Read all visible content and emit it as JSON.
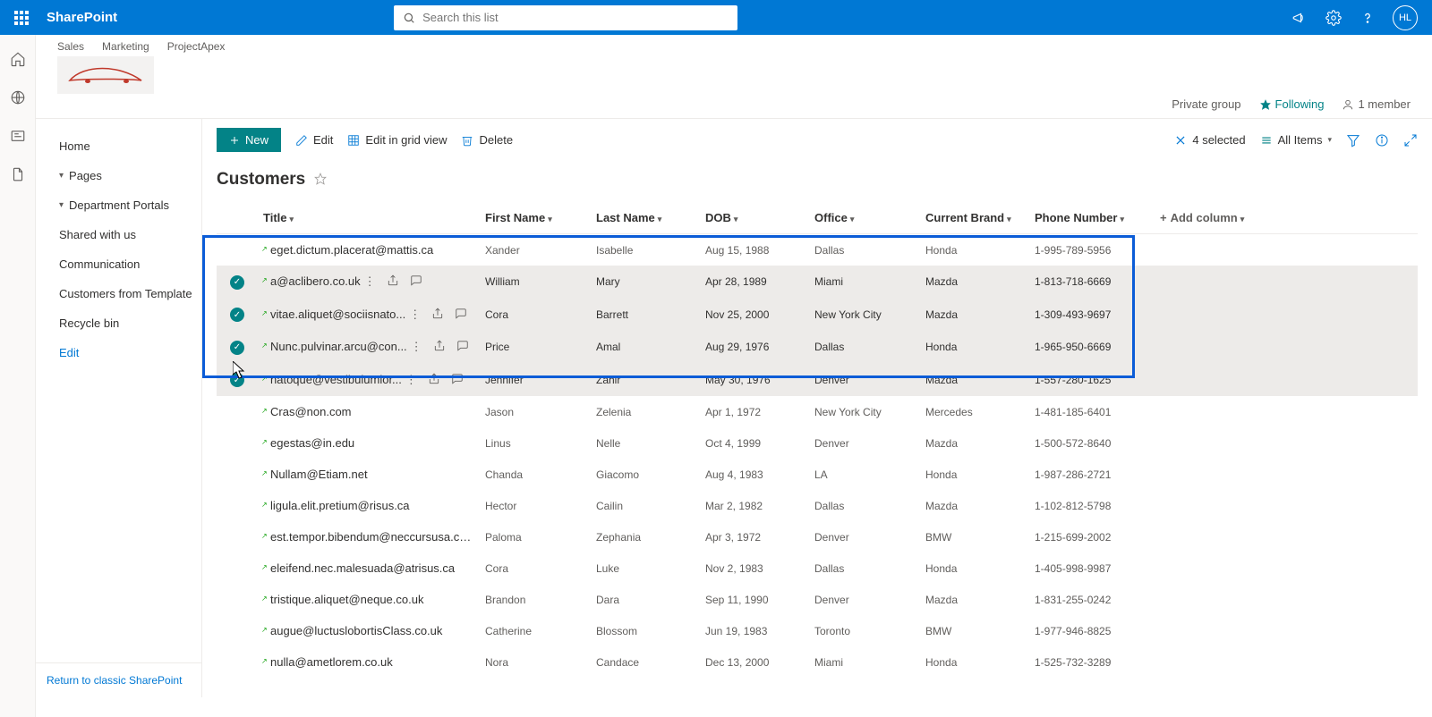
{
  "topbar": {
    "brand": "SharePoint",
    "search_placeholder": "Search this list",
    "avatar_initials": "HL"
  },
  "site": {
    "pivots": [
      "Sales",
      "Marketing",
      "ProjectApex"
    ],
    "privacy": "Private group",
    "following_label": "Following",
    "members_label": "1 member"
  },
  "sidenav": {
    "home": "Home",
    "pages": "Pages",
    "portals": "Department Portals",
    "shared": "Shared with us",
    "comm": "Communication",
    "cust": "Customers from Template",
    "recycle": "Recycle bin",
    "edit": "Edit",
    "classic": "Return to classic SharePoint"
  },
  "commands": {
    "new": "New",
    "edit": "Edit",
    "grid": "Edit in grid view",
    "delete": "Delete",
    "selected": "4 selected",
    "view": "All Items"
  },
  "list": {
    "title": "Customers",
    "columns": {
      "title": "Title",
      "first_name": "First Name",
      "last_name": "Last Name",
      "dob": "DOB",
      "office": "Office",
      "brand": "Current Brand",
      "phone": "Phone Number",
      "add": "Add column"
    },
    "rows": [
      {
        "sel": false,
        "title": "eget.dictum.placerat@mattis.ca",
        "fn": "Xander",
        "ln": "Isabelle",
        "dob": "Aug 15, 1988",
        "off": "Dallas",
        "brand": "Honda",
        "phone": "1-995-789-5956"
      },
      {
        "sel": true,
        "title": "a@aclibero.co.uk",
        "fn": "William",
        "ln": "Mary",
        "dob": "Apr 28, 1989",
        "off": "Miami",
        "brand": "Mazda",
        "phone": "1-813-718-6669"
      },
      {
        "sel": true,
        "title": "vitae.aliquet@sociisnato...",
        "fn": "Cora",
        "ln": "Barrett",
        "dob": "Nov 25, 2000",
        "off": "New York City",
        "brand": "Mazda",
        "phone": "1-309-493-9697"
      },
      {
        "sel": true,
        "title": "Nunc.pulvinar.arcu@con...",
        "fn": "Price",
        "ln": "Amal",
        "dob": "Aug 29, 1976",
        "off": "Dallas",
        "brand": "Honda",
        "phone": "1-965-950-6669"
      },
      {
        "sel": true,
        "title": "natoque@vestibulumlor...",
        "fn": "Jennifer",
        "ln": "Zahir",
        "dob": "May 30, 1976",
        "off": "Denver",
        "brand": "Mazda",
        "phone": "1-557-280-1625"
      },
      {
        "sel": false,
        "title": "Cras@non.com",
        "fn": "Jason",
        "ln": "Zelenia",
        "dob": "Apr 1, 1972",
        "off": "New York City",
        "brand": "Mercedes",
        "phone": "1-481-185-6401"
      },
      {
        "sel": false,
        "title": "egestas@in.edu",
        "fn": "Linus",
        "ln": "Nelle",
        "dob": "Oct 4, 1999",
        "off": "Denver",
        "brand": "Mazda",
        "phone": "1-500-572-8640"
      },
      {
        "sel": false,
        "title": "Nullam@Etiam.net",
        "fn": "Chanda",
        "ln": "Giacomo",
        "dob": "Aug 4, 1983",
        "off": "LA",
        "brand": "Honda",
        "phone": "1-987-286-2721"
      },
      {
        "sel": false,
        "title": "ligula.elit.pretium@risus.ca",
        "fn": "Hector",
        "ln": "Cailin",
        "dob": "Mar 2, 1982",
        "off": "Dallas",
        "brand": "Mazda",
        "phone": "1-102-812-5798"
      },
      {
        "sel": false,
        "title": "est.tempor.bibendum@neccursusa.com",
        "fn": "Paloma",
        "ln": "Zephania",
        "dob": "Apr 3, 1972",
        "off": "Denver",
        "brand": "BMW",
        "phone": "1-215-699-2002"
      },
      {
        "sel": false,
        "title": "eleifend.nec.malesuada@atrisus.ca",
        "fn": "Cora",
        "ln": "Luke",
        "dob": "Nov 2, 1983",
        "off": "Dallas",
        "brand": "Honda",
        "phone": "1-405-998-9987"
      },
      {
        "sel": false,
        "title": "tristique.aliquet@neque.co.uk",
        "fn": "Brandon",
        "ln": "Dara",
        "dob": "Sep 11, 1990",
        "off": "Denver",
        "brand": "Mazda",
        "phone": "1-831-255-0242"
      },
      {
        "sel": false,
        "title": "augue@luctuslobortisClass.co.uk",
        "fn": "Catherine",
        "ln": "Blossom",
        "dob": "Jun 19, 1983",
        "off": "Toronto",
        "brand": "BMW",
        "phone": "1-977-946-8825"
      },
      {
        "sel": false,
        "title": "nulla@ametlorem.co.uk",
        "fn": "Nora",
        "ln": "Candace",
        "dob": "Dec 13, 2000",
        "off": "Miami",
        "brand": "Honda",
        "phone": "1-525-732-3289"
      }
    ]
  }
}
